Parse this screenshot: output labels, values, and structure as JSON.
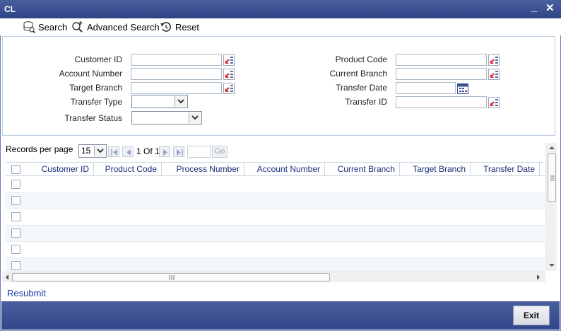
{
  "window": {
    "title": "CL",
    "minimize_label": "_",
    "close_label": "✕"
  },
  "toolbar": {
    "search_label": "Search",
    "advanced_search_label": "Advanced Search",
    "reset_label": "Reset"
  },
  "criteria": {
    "customer_id_label": "Customer ID",
    "account_number_label": "Account Number",
    "target_branch_label": "Target Branch",
    "transfer_type_label": "Transfer Type",
    "transfer_status_label": "Transfer Status",
    "product_code_label": "Product Code",
    "current_branch_label": "Current Branch",
    "transfer_date_label": "Transfer Date",
    "transfer_id_label": "Transfer ID",
    "customer_id_value": "",
    "account_number_value": "",
    "target_branch_value": "",
    "transfer_type_value": "",
    "transfer_status_value": "",
    "product_code_value": "",
    "current_branch_value": "",
    "transfer_date_value": "",
    "transfer_id_value": ""
  },
  "pager": {
    "records_per_page_label": "Records per page",
    "records_per_page_value": "15",
    "page_info": "1 Of 1",
    "go_label": "Go"
  },
  "grid": {
    "columns": [
      "Customer ID",
      "Product Code",
      "Process Number",
      "Account Number",
      "Current Branch",
      "Target Branch",
      "Transfer Date"
    ],
    "rows": [
      {},
      {},
      {},
      {},
      {},
      {}
    ]
  },
  "actions": {
    "resubmit_label": "Resubmit",
    "exit_label": "Exit"
  },
  "colors": {
    "title_bar": "#3a4f93",
    "header_text": "#1a2f7a",
    "link": "#1a3bb0"
  }
}
